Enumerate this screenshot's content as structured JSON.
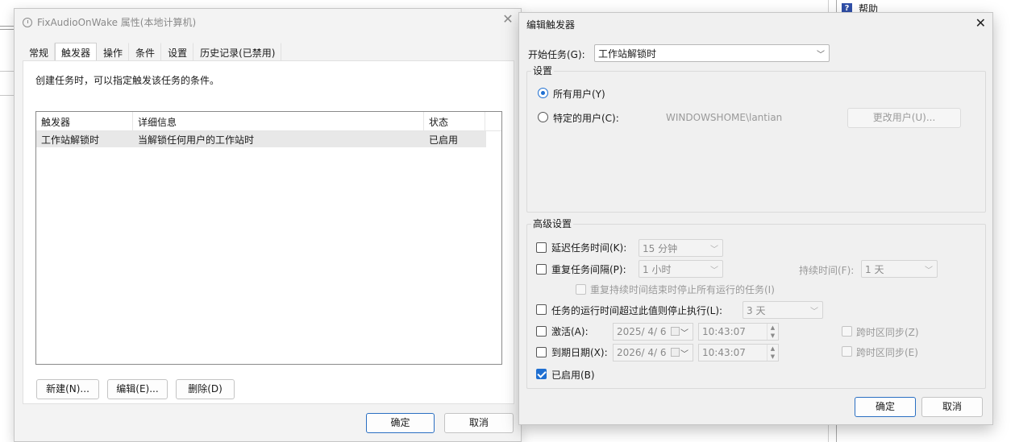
{
  "background": {
    "help_label": "帮助"
  },
  "props_dialog": {
    "title": "FixAudioOnWake 属性(本地计算机)",
    "tabs": [
      "常规",
      "触发器",
      "操作",
      "条件",
      "设置",
      "历史记录(已禁用)"
    ],
    "active_tab": "触发器",
    "description": "创建任务时，可以指定触发该任务的条件。",
    "table": {
      "columns": [
        "触发器",
        "详细信息",
        "状态"
      ],
      "rows": [
        {
          "trigger": "工作站解锁时",
          "details": "当解锁任何用户的工作站时",
          "status": "已启用"
        }
      ]
    },
    "buttons": {
      "new": "新建(N)...",
      "edit": "编辑(E)...",
      "delete": "删除(D)",
      "ok": "确定",
      "cancel": "取消"
    }
  },
  "edit_dialog": {
    "title": "编辑触发器",
    "begin_task_label": "开始任务(G):",
    "begin_task_value": "工作站解锁时",
    "settings_group": "设置",
    "all_users_label": "所有用户(Y)",
    "specific_user_label": "特定的用户(C):",
    "user_name": "WINDOWSHOME\\lantian",
    "change_user_button": "更改用户(U)...",
    "advanced_group": "高级设置",
    "delay_label": "延迟任务时间(K):",
    "delay_value": "15 分钟",
    "repeat_label": "重复任务间隔(P):",
    "repeat_value": "1 小时",
    "duration_label": "持续时间(F):",
    "duration_value": "1 天",
    "stop_all_label": "重复持续时间结束时停止所有运行的任务(I)",
    "stop_if_label": "任务的运行时间超过此值则停止执行(L):",
    "stop_if_value": "3 天",
    "activate_label": "激活(A):",
    "activate_date": "2025/  4/  6",
    "activate_time": "10:43:07",
    "expire_label": "到期日期(X):",
    "expire_date": "2026/  4/  6",
    "expire_time": "10:43:07",
    "sync_z_label": "跨时区同步(Z)",
    "sync_e_label": "跨时区同步(E)",
    "enabled_label": "已启用(B)",
    "ok_button": "确定",
    "cancel_button": "取消"
  }
}
